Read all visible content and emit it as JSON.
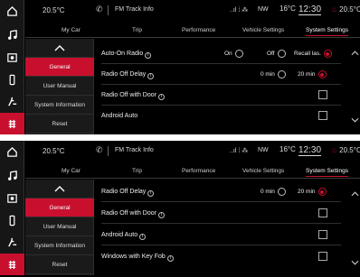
{
  "status": {
    "weather": "20.5°C",
    "phone_icon": "phone-icon",
    "app_title": "FM Track Info",
    "signal_icons": "..ıl ⁞ ⁂",
    "compass": "NW",
    "temp_small": "16°C",
    "clock": "12:30",
    "temp_right": "20.5°C"
  },
  "tabs": [
    "My Car",
    "Trip",
    "Performance",
    "Vehicle Settings",
    "System Settings"
  ],
  "submenu": {
    "general": "General",
    "user_manual": "User Manual",
    "system_information": "System Information",
    "reset": "Reset"
  },
  "screen_top": {
    "rows": [
      {
        "label": "Auto-On Radio",
        "options": [
          "On",
          "Off",
          "Recall las."
        ]
      },
      {
        "label": "Radio Off Delay",
        "options": [
          "0 min",
          "20 min"
        ]
      },
      {
        "label": "Radio Off with Door"
      },
      {
        "label": "Android Auto"
      }
    ]
  },
  "screen_bottom": {
    "rows": [
      {
        "label": "Radio Off Delay",
        "options": [
          "0 min",
          "20 min"
        ]
      },
      {
        "label": "Radio Off with Door"
      },
      {
        "label": "Android Auto"
      },
      {
        "label": "Windows with Key Fob"
      }
    ]
  },
  "colors": {
    "accent": "#c8102e",
    "background": "#000000",
    "rail": "#161616"
  }
}
